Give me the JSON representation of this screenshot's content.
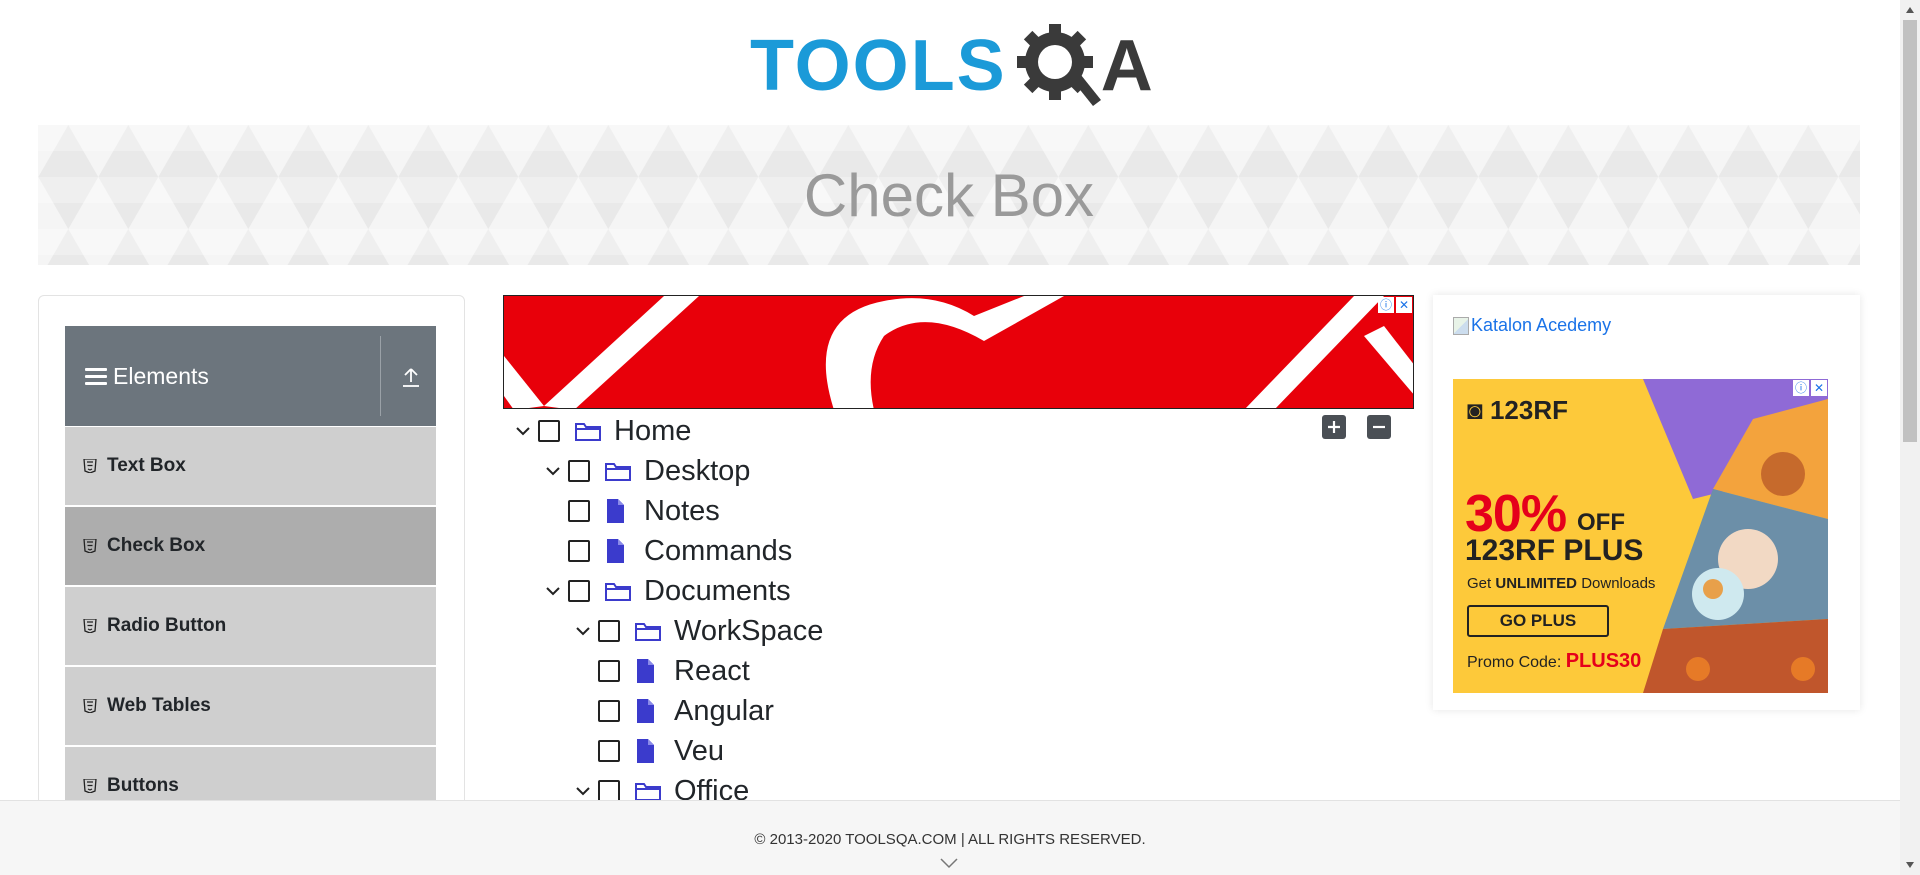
{
  "header": {
    "logo_tools": "TOOLS",
    "logo_a": "A"
  },
  "banner": {
    "title": "Check Box"
  },
  "sidebar": {
    "group_title": "Elements",
    "items": [
      {
        "label": "Text Box",
        "active": false
      },
      {
        "label": "Check Box",
        "active": true
      },
      {
        "label": "Radio Button",
        "active": false
      },
      {
        "label": "Web Tables",
        "active": false
      },
      {
        "label": "Buttons",
        "active": false
      }
    ]
  },
  "tree": {
    "nodes": [
      {
        "label": "Home",
        "type": "folder",
        "expanded": true
      },
      {
        "label": "Desktop",
        "type": "folder",
        "expanded": true
      },
      {
        "label": "Notes",
        "type": "file"
      },
      {
        "label": "Commands",
        "type": "file"
      },
      {
        "label": "Documents",
        "type": "folder",
        "expanded": true
      },
      {
        "label": "WorkSpace",
        "type": "folder",
        "expanded": true
      },
      {
        "label": "React",
        "type": "file"
      },
      {
        "label": "Angular",
        "type": "file"
      },
      {
        "label": "Veu",
        "type": "file"
      },
      {
        "label": "Office",
        "type": "folder",
        "expanded": true
      }
    ],
    "expand_all_icon": "plus-icon",
    "collapse_all_icon": "minus-icon"
  },
  "right_ad": {
    "katalon_alt": "Katalon Acedemy",
    "brand": "123RF",
    "percent": "30%",
    "off": "OFF",
    "plus": "123RF PLUS",
    "unlimited_prefix": "Get ",
    "unlimited_bold": "UNLIMITED",
    "unlimited_suffix": " Downloads",
    "cta": "GO PLUS",
    "promo_prefix": "Promo Code: ",
    "promo_code": "PLUS30"
  },
  "footer": {
    "copyright": "© 2013-2020 TOOLSQA.COM | ALL RIGHTS RESERVED."
  },
  "colors": {
    "brand_blue": "#1b9ad8",
    "brand_dark": "#3a3a3a",
    "sidebar_header": "#6c757d",
    "menu_item": "#cfcfcf",
    "menu_item_active": "#adadad",
    "ad_red": "#e8000a",
    "ad_yellow": "#fdc93a",
    "tree_icon": "#3b3bcc"
  }
}
